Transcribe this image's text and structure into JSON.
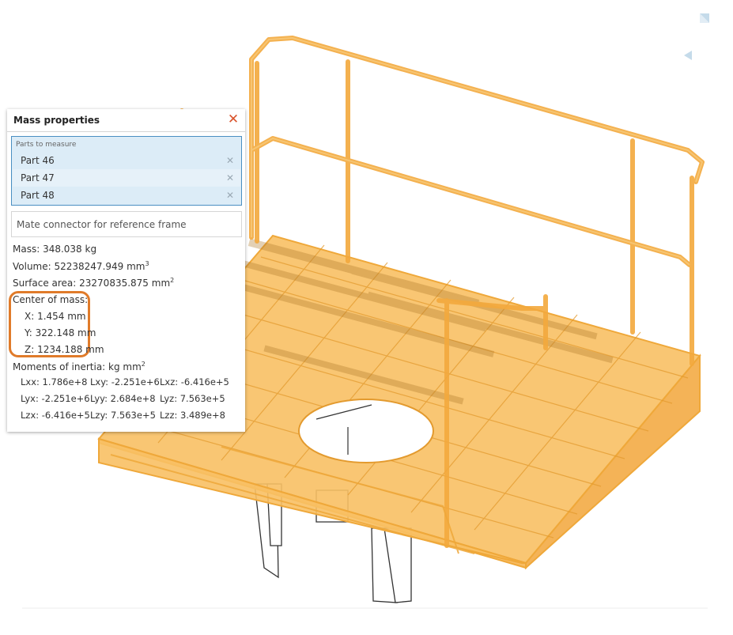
{
  "panel": {
    "title": "Mass properties",
    "close_icon": "✕",
    "parts_caption": "Parts to measure",
    "parts": [
      {
        "label": "Part 46",
        "remove_icon": "✕"
      },
      {
        "label": "Part 47",
        "remove_icon": "✕"
      },
      {
        "label": "Part 48",
        "remove_icon": "✕"
      }
    ],
    "mate_placeholder": "Mate connector for reference frame",
    "mass": "Mass: 348.038 kg",
    "volume": "Volume: 52238247.949 mm",
    "volume_exp": "3",
    "surface": "Surface area: 23270835.875 mm",
    "surface_exp": "2",
    "com_label": "Center of mass:",
    "com_x": "X: 1.454 mm",
    "com_y": "Y: 322.148 mm",
    "com_z": "Z: 1234.188 mm",
    "inertia_label": "Moments of inertia: kg mm",
    "inertia_exp": "2",
    "inertia": [
      [
        "Lxx: 1.786e+8",
        "Lxy: -2.251e+6",
        "Lxz: -6.416e+5"
      ],
      [
        "Lyx: -2.251e+6",
        "Lyy: 2.684e+8",
        "Lyz: 7.563e+5"
      ],
      [
        "Lzx: -6.416e+5",
        "Lzy: 7.563e+5",
        "Lzz: 3.489e+8"
      ]
    ]
  },
  "colors": {
    "model_fill": "#f8c064",
    "model_stroke": "#efa83a",
    "highlight": "#e07b2a",
    "close": "#d9532c",
    "selection_bg": "#dcecf7",
    "selection_border": "#4a8fc2"
  },
  "icons": {
    "view_cube": "view-cube-icon",
    "view_arrow": "view-arrow-icon"
  }
}
